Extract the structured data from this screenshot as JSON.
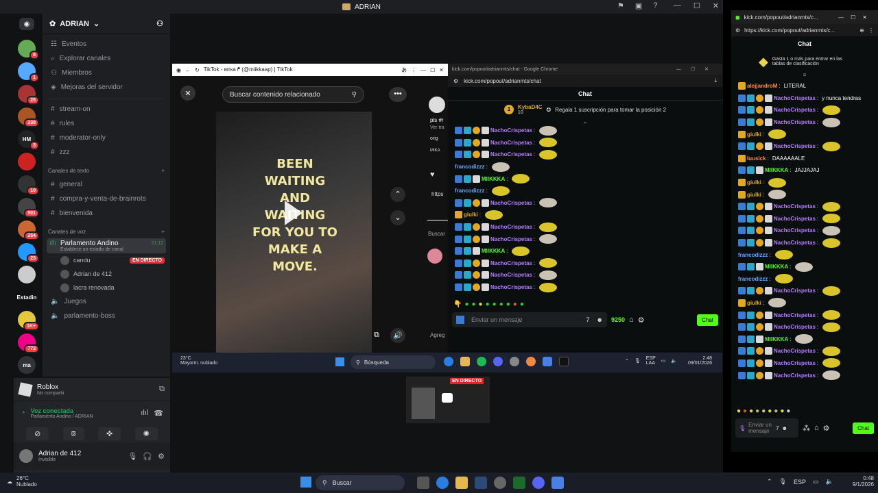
{
  "discord": {
    "title": "ADRIAN",
    "server_name": "ADRIAN",
    "servers": [
      {
        "badge": "8",
        "color": "#6a5"
      },
      {
        "badge": "1",
        "color": "#5af"
      },
      {
        "badge": "25",
        "color": "#a33"
      },
      {
        "badge": "338",
        "color": "#a52"
      },
      {
        "label": "HM",
        "badge": "3",
        "color": "#222"
      },
      {
        "badge": "",
        "color": "#c22"
      },
      {
        "badge": "10",
        "color": "#333"
      },
      {
        "badge": "501",
        "color": "#444"
      },
      {
        "badge": "254",
        "color": "#c63"
      },
      {
        "badge": "23",
        "color": "#29f"
      },
      {
        "badge": "",
        "color": "#ccc"
      },
      {
        "label": "Estadin",
        "badge": "",
        "color": "#111"
      },
      {
        "badge": "1K+",
        "color": "#e2c83a"
      },
      {
        "badge": "773",
        "color": "#e08"
      },
      {
        "label": "ma",
        "badge": "",
        "color": "#313338"
      },
      {
        "badge": "",
        "color": "#911"
      },
      {
        "badge": "",
        "color": "#777"
      }
    ],
    "top_items": [
      "Eventos",
      "Explorar canales",
      "Miembros",
      "Mejoras del servidor"
    ],
    "channels_a": [
      "stream-on",
      "rules",
      "moderator-only",
      "zzz"
    ],
    "cat_text": "Canales de texto",
    "text_channels": [
      "general",
      "compra-y-venta-de-brainrots",
      "bienvenida"
    ],
    "cat_voice": "Canales de voz",
    "voice_channel": "Parlamento Andino",
    "voice_time": "21:12",
    "voice_status": "Establece un estado de canal",
    "voice_users": [
      "candu",
      "Adrian de 412",
      "lacra renovada"
    ],
    "live_badge": "EN DIRECTO",
    "channels_b": [
      "Juegos",
      "parlamento-boss"
    ],
    "activity_title": "Roblox",
    "activity_sub": "No compartir",
    "voice_connected": "Voz conectada",
    "voice_where": "Parlamento Andino / ADRIAN",
    "user_name": "Adrian de 412",
    "user_status": "Invisible"
  },
  "tiktok": {
    "tab_title": "TikTok - мткa ᖰ (@miikkaap) | TikTok",
    "search_placeholder": "Buscar contenido relacionado",
    "caption": "BEEN WAITING AND WAITING FOR YOU TO MAKE A MOVE.",
    "side_text": [
      "pls #r",
      "Ver tra",
      "orig",
      "MIKA",
      "Buscar",
      "https",
      "Agreg"
    ]
  },
  "kick_small": {
    "tab": "kick.com/popout/adrianmts/chat - Google Chrome",
    "url": "kick.com/popout/adrianmts/chat",
    "chat_title": "Chat",
    "gifter_name": "KybaD4C",
    "gifter_count": "10",
    "gift_text": "Regala 1 suscripción para tomar la posición 2",
    "messages": [
      {
        "user": "NachoCrispetas",
        "kind": "n"
      },
      {
        "user": "NachoCrispetas",
        "kind": "n"
      },
      {
        "user": "NachoCrispetas",
        "kind": "n"
      },
      {
        "user": "francodizzz",
        "kind": "b"
      },
      {
        "user": "MIIKKKA",
        "kind": "m"
      },
      {
        "user": "francodizzz",
        "kind": "b"
      },
      {
        "user": "NachoCrispetas",
        "kind": "n"
      },
      {
        "user": "giulki",
        "kind": "g"
      },
      {
        "user": "NachoCrispetas",
        "kind": "n"
      },
      {
        "user": "NachoCrispetas",
        "kind": "n"
      },
      {
        "user": "MIIKKKA",
        "kind": "m"
      },
      {
        "user": "NachoCrispetas",
        "kind": "n"
      },
      {
        "user": "NachoCrispetas",
        "kind": "n"
      },
      {
        "user": "NachoCrispetas",
        "kind": "n"
      }
    ],
    "input_placeholder": "Enviar un mensaje",
    "points": "9250",
    "chat_button": "Chat"
  },
  "inner_taskbar": {
    "temp": "23°C",
    "weather": "Mayorm. nublado",
    "search": "Búsqueda",
    "lang": "ESP",
    "lang2": "LAA",
    "time": "2:48",
    "date": "09/01/2026"
  },
  "stream_preview": {
    "badge": "EN DIRECTO"
  },
  "kick_right": {
    "tab": "kick.com/popout/adrianmts/c...",
    "url": "https://kick.com/popout/adrianmts/c...",
    "chat_title": "Chat",
    "promo_text": "Gasta 1  o más para entrar en las tablas de clasificación",
    "messages": [
      {
        "user": "alejjandroM",
        "text": "LITERAL",
        "kind": "plain"
      },
      {
        "user": "NachoCrispetas",
        "text": "y nunca tendras",
        "kind": "n"
      },
      {
        "user": "NachoCrispetas",
        "text": "",
        "kind": "n"
      },
      {
        "user": "NachoCrispetas",
        "text": "",
        "kind": "n"
      },
      {
        "user": "giulki",
        "text": "",
        "kind": "g"
      },
      {
        "user": "NachoCrispetas",
        "text": "",
        "kind": "n"
      },
      {
        "user": "luusick",
        "text": "DAAAAAALE",
        "kind": "plain"
      },
      {
        "user": "MIIKKKA",
        "text": "JAJJAJAJ",
        "kind": "m"
      },
      {
        "user": "giulki",
        "text": "",
        "kind": "g"
      },
      {
        "user": "giulki",
        "text": "",
        "kind": "g"
      },
      {
        "user": "NachoCrispetas",
        "text": "",
        "kind": "n"
      },
      {
        "user": "NachoCrispetas",
        "text": "",
        "kind": "n"
      },
      {
        "user": "NachoCrispetas",
        "text": "",
        "kind": "n"
      },
      {
        "user": "NachoCrispetas",
        "text": "",
        "kind": "n"
      },
      {
        "user": "francodizzz",
        "text": "",
        "kind": "b"
      },
      {
        "user": "MIIKKKA",
        "text": "",
        "kind": "m"
      },
      {
        "user": "francodizzz",
        "text": "",
        "kind": "b"
      },
      {
        "user": "NachoCrispetas",
        "text": "",
        "kind": "n"
      },
      {
        "user": "giulki",
        "text": "",
        "kind": "g"
      },
      {
        "user": "NachoCrispetas",
        "text": "",
        "kind": "n"
      },
      {
        "user": "NachoCrispetas",
        "text": "",
        "kind": "n"
      },
      {
        "user": "MIIKKKA",
        "text": "",
        "kind": "m"
      },
      {
        "user": "NachoCrispetas",
        "text": "",
        "kind": "n"
      },
      {
        "user": "NachoCrispetas",
        "text": "",
        "kind": "n"
      },
      {
        "user": "NachoCrispetas",
        "text": "",
        "kind": "n"
      }
    ],
    "input_placeholder": "Enviar un mensaje",
    "chat_button": "Chat"
  },
  "taskbar": {
    "temp": "26°C",
    "weather": "Nublado",
    "search": "Buscar",
    "lang": "ESP",
    "time": "0:48",
    "date": "9/1/2026"
  }
}
